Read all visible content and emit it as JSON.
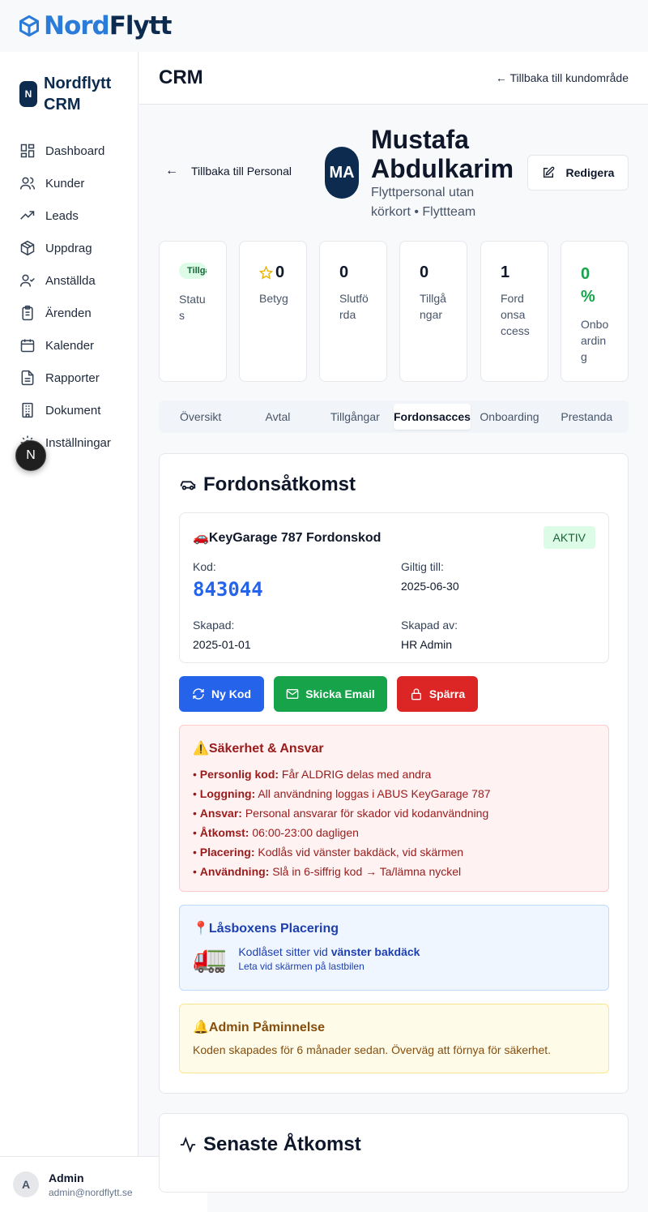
{
  "brand": {
    "part1": "Nord",
    "part2": "Flytt"
  },
  "sidebar": {
    "badge": "N",
    "title": "Nordflytt CRM",
    "items": [
      {
        "label": "Dashboard",
        "icon": "dashboard-icon"
      },
      {
        "label": "Kunder",
        "icon": "users-icon"
      },
      {
        "label": "Leads",
        "icon": "trending-icon"
      },
      {
        "label": "Uppdrag",
        "icon": "package-icon"
      },
      {
        "label": "Anställda",
        "icon": "user-check-icon"
      },
      {
        "label": "Ärenden",
        "icon": "clipboard-icon"
      },
      {
        "label": "Kalender",
        "icon": "calendar-icon"
      },
      {
        "label": "Rapporter",
        "icon": "file-text-icon"
      },
      {
        "label": "Dokument",
        "icon": "building-icon"
      },
      {
        "label": "Inställningar",
        "icon": "gear-icon"
      }
    ],
    "fab": "N"
  },
  "user": {
    "initial": "A",
    "name": "Admin",
    "email": "admin@nordflytt.se"
  },
  "header": {
    "title": "CRM",
    "back_link": "← Tillbaka till kundområde"
  },
  "profile": {
    "back_label": "Tillbaka till Personal",
    "initials": "MA",
    "name": "Mustafa Abdulkarim",
    "role": "Flyttpersonal utan körkort • Flyttteam",
    "edit_label": "Redigera"
  },
  "stats": [
    {
      "value": "Tillgänglig",
      "label": "Status",
      "kind": "chip"
    },
    {
      "value": "0",
      "label": "Betyg",
      "kind": "star"
    },
    {
      "value": "0",
      "label": "Slutförda"
    },
    {
      "value": "0",
      "label": "Tillgångar"
    },
    {
      "value": "1",
      "label": "Fordonsaccess"
    },
    {
      "value": "0 %",
      "label": "Onboarding",
      "color": "#16a34a"
    }
  ],
  "tabs": [
    "Översikt",
    "Avtal",
    "Tillgångar",
    "Fordonsaccess",
    "Onboarding",
    "Prestanda"
  ],
  "active_tab": "Fordonsaccess",
  "vehicle": {
    "title": "Fordonsåtkomst",
    "code_title": "🚗KeyGarage 787 Fordonskod",
    "status": "AKTIV",
    "code_label": "Kod:",
    "code": "843044",
    "valid_label": "Giltig till:",
    "valid": "2025-06-30",
    "created_label": "Skapad:",
    "created": "2025-01-01",
    "created_by_label": "Skapad av:",
    "created_by": "HR Admin",
    "btn_new": "Ny Kod",
    "btn_email": "Skicka Email",
    "btn_block": "Spärra"
  },
  "security": {
    "title": "⚠️Säkerhet & Ansvar",
    "items": [
      {
        "k": "Personlig kod:",
        "v": " Får ALDRIG delas med andra"
      },
      {
        "k": "Loggning:",
        "v": " All användning loggas i ABUS KeyGarage 787"
      },
      {
        "k": "Ansvar:",
        "v": " Personal ansvarar för skador vid kodanvändning"
      },
      {
        "k": "Åtkomst:",
        "v": " 06:00-23:00 dagligen"
      },
      {
        "k": "Placering:",
        "v": " Kodlås vid vänster bakdäck, vid skärmen"
      },
      {
        "k": "Användning:",
        "v": " Slå in 6-siffrig kod → Ta/lämna nyckel"
      }
    ]
  },
  "placement": {
    "title": "📍Låsboxens Placering",
    "line1_pre": "Kodlåset sitter vid ",
    "line1_bold": "vänster bakdäck",
    "line2": "Leta vid skärmen på lastbilen"
  },
  "reminder": {
    "title": "🔔Admin Påminnelse",
    "text": "Koden skapades för 6 månader sedan. Överväg att förnya för säkerhet."
  },
  "recent": {
    "title": "Senaste Åtkomst"
  },
  "colors": {
    "navy": "#0c2b4e",
    "blue": "#2563eb",
    "green": "#16a34a",
    "red": "#dc2626"
  }
}
